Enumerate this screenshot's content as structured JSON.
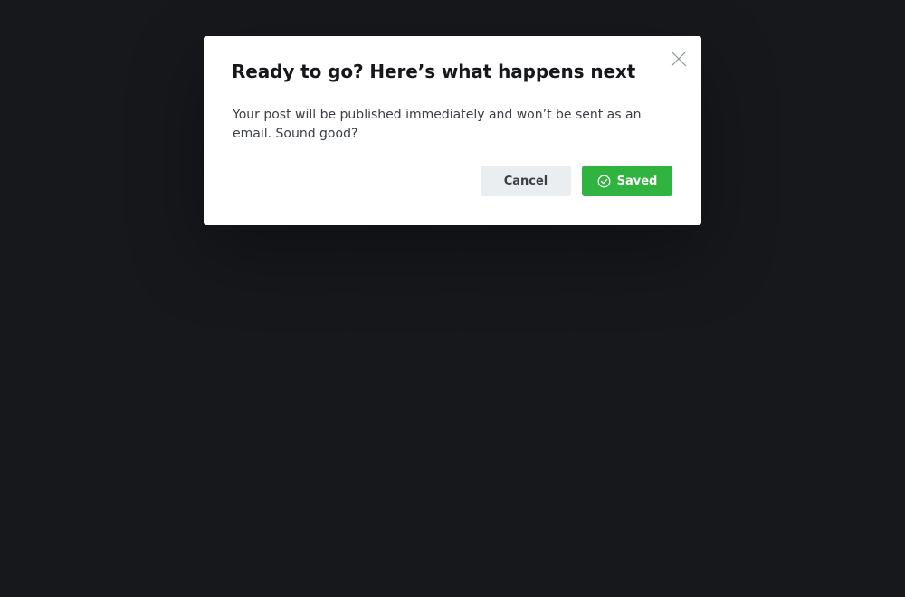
{
  "modal": {
    "title": "Ready to go? Here’s what happens next",
    "body": "Your post will be published immediately and won’t be sent as an email. Sound good?",
    "close_icon": "close-icon",
    "buttons": {
      "cancel_label": "Cancel",
      "saved_label": "Saved",
      "saved_icon": "check-circle-icon"
    }
  },
  "colors": {
    "backdrop": "#17181c",
    "modal_bg": "#ffffff",
    "accent_green": "#30b33f",
    "cancel_bg": "#ebeef0",
    "title_text": "#15171a"
  }
}
